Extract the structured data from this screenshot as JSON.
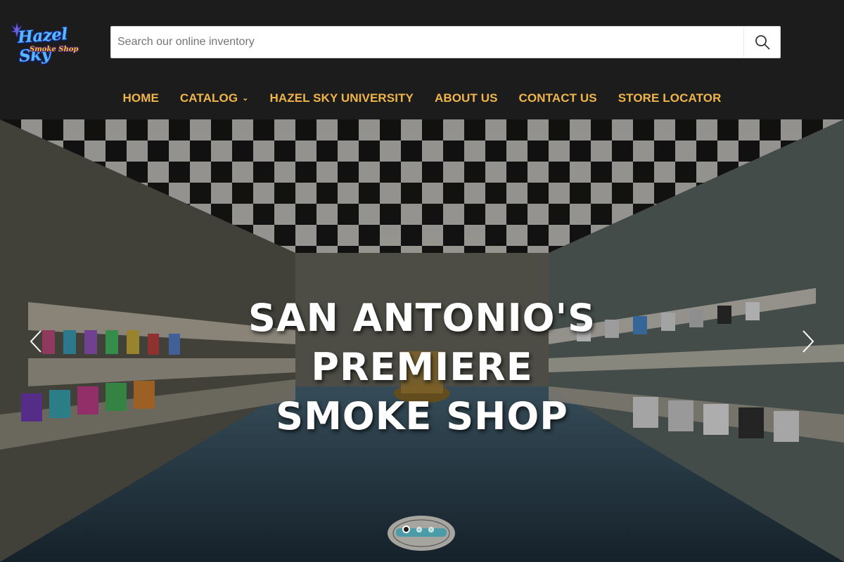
{
  "brand": {
    "logo_top": "Hazel Sky",
    "logo_bottom": "Smoke Shop",
    "colors": {
      "nav_text": "#f0b54a",
      "header_bg": "#1c1c1c"
    }
  },
  "search": {
    "placeholder": "Search our online inventory",
    "icon": "search-icon"
  },
  "nav": {
    "items": [
      {
        "label": "HOME"
      },
      {
        "label": "CATALOG",
        "has_dropdown": true
      },
      {
        "label": "HAZEL SKY UNIVERSITY"
      },
      {
        "label": "ABOUT US"
      },
      {
        "label": "CONTACT US"
      },
      {
        "label": "STORE LOCATOR"
      }
    ]
  },
  "hero": {
    "title_line1": "SAN ANTONIO'S PREMIERE",
    "title_line2": "SMOKE SHOP",
    "prev_icon": "chevron-left-icon",
    "next_icon": "chevron-right-icon",
    "slides": 3,
    "active_slide": 1
  }
}
